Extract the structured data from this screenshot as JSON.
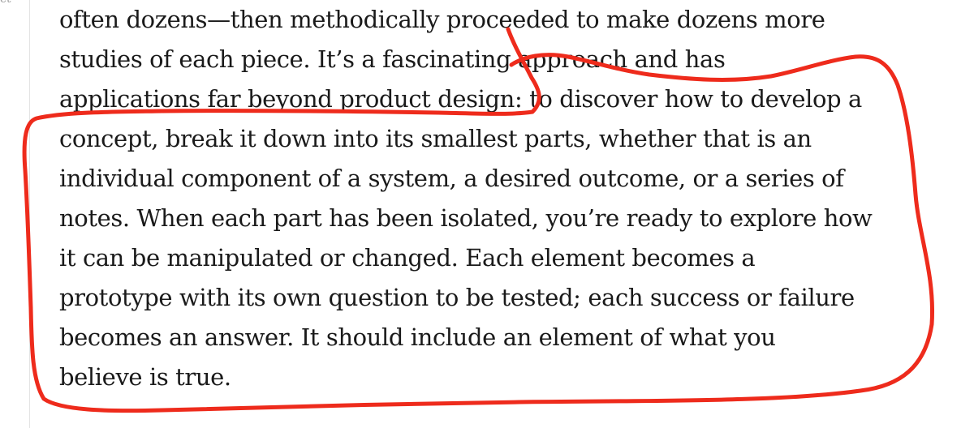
{
  "page": {
    "corner_fragment": "ct"
  },
  "paragraph": {
    "lines": [
      "often dozens—then methodically proceeded to make dozens more",
      "studies of each piece. It’s a fascinating approach and has",
      "applications far beyond product design: to discover how to develop a",
      "concept, break it down into its smallest parts, whether that is an",
      "individual component of a system, a desired outcome, or a series of",
      "notes. When each part has been isolated, you’re ready to explore how",
      "it can be manipulated or changed. Each element becomes a",
      "prototype with its own question to be tested; each success or failure",
      "becomes an answer. It should include an element of what you",
      "believe is true."
    ]
  },
  "annotation": {
    "stroke_color": "#ee2b1c"
  }
}
